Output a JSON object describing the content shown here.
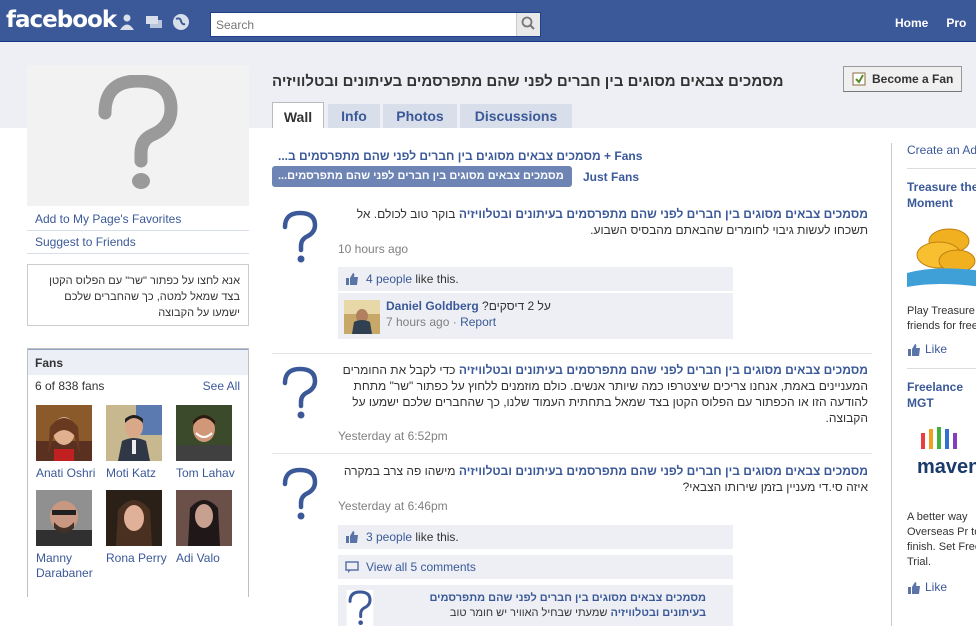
{
  "header": {
    "logo": "facebook",
    "search_placeholder": "Search",
    "nav": [
      "Home",
      "Pro"
    ]
  },
  "page": {
    "title": "מסמכים צבאים מסוגים בין חברים לפני שהם מתפרסמים בעיתונים ובטלוויזיה",
    "become_fan": "Become a Fan",
    "tabs": [
      "Wall",
      "Info",
      "Photos",
      "Discussions"
    ]
  },
  "left": {
    "links": [
      "Add to My Page's Favorites",
      "Suggest to Friends"
    ],
    "promo": "אנא לחצו על כפתור \"שר\" עם הפלוס הקטן בצד שמאל למטה, כך שהחברים שלכם ישמעו על הקבוצה",
    "fans": {
      "heading": "Fans",
      "count_text": "6 of 838 fans",
      "see_all": "See All",
      "people": [
        {
          "name": "Anati Oshri"
        },
        {
          "name": "Moti Katz"
        },
        {
          "name": "Tom Lahav"
        },
        {
          "name": "Manny Darabaner"
        },
        {
          "name": "Rona Perry"
        },
        {
          "name": "Adi Valo"
        }
      ]
    }
  },
  "wall": {
    "filter_fans": "...מסמכים צבאים מסוגים בין חברים לפני שהם מתפרסמים ב + Fans",
    "filter_page_btn": "...מסמכים צבאים מסוגים בין חברים לפני שהם מתפרסמים ב",
    "filter_just_fans": "Just Fans",
    "stories": [
      {
        "author": "מסמכים צבאים מסוגים בין חברים לפני שהם מתפרסמים בעיתונים ובטלוויזיה",
        "text": "בוקר טוב לכולם. אל תשכחו לעשות גיבוי לחומרים שהבאתם מהבסיס השבוע.",
        "time": "10 hours ago",
        "likes_count": "4 people",
        "likes_suffix": "like this.",
        "comment": {
          "author": "Daniel Goldberg",
          "text": "על 2 דיסקים?",
          "time": "7 hours ago",
          "report": "Report"
        }
      },
      {
        "author": "מסמכים צבאים מסוגים בין חברים לפני שהם מתפרסמים בעיתונים ובטלוויזיה",
        "text": "כדי לקבל את החומרים המעניינים באמת, אנחנו צריכים שיצטרפו כמה שיותר אנשים. כולם מוזמנים ללחוץ על כפתור \"שר\" מתחת להודעה הזו או הכפתור עם הפלוס הקטן בצד שמאל בתחתית העמוד שלנו, כך שהחברים שלכם ישמעו על הקבוצה.",
        "time": "Yesterday at 6:52pm"
      },
      {
        "author": "מסמכים צבאים מסוגים בין חברים לפני שהם מתפרסמים בעיתונים ובטלוויזיה",
        "text": "מישהו פה צרב במקרה איזה סי.די מעניין בזמן שירותו הצבאי?",
        "time": "Yesterday at 6:46pm",
        "likes_count": "3 people",
        "likes_suffix": "like this.",
        "view_comments": "View all 5 comments",
        "comment": {
          "author": "מסמכים צבאים מסוגים בין חברים לפני שהם מתפרסמים בעיתונים ובטלוויזיה",
          "text": "שמעתי שבחיל האוויר יש חומר טוב"
        }
      }
    ]
  },
  "right": {
    "create_ad": "Create an Ad",
    "ads": [
      {
        "title": "Treasure the Moment",
        "text": "Play Treasure friends for free",
        "like": "Like"
      },
      {
        "title": "Freelance MGT",
        "text": "A better way Overseas Pr to finish. Set Free Trial.",
        "like": "Like"
      }
    ]
  },
  "colors": {
    "brand": "#3b5998",
    "band": "#edeff4",
    "ufi": "#edeff4"
  }
}
